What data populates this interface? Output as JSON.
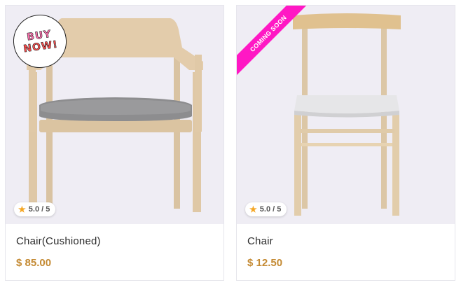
{
  "products": [
    {
      "title": "Chair(Cushioned)",
      "price": "$ 85.00",
      "rating": "5.0 / 5",
      "badge_line1": "BUY",
      "badge_line2": "NOW!"
    },
    {
      "title": "Chair",
      "price": "$ 12.50",
      "rating": "5.0 / 5",
      "ribbon": "COMING SOON"
    }
  ],
  "icons": {
    "rating": "star-icon"
  },
  "colors": {
    "price": "#c48a33",
    "star": "#f5a623",
    "ribbon": "#ff18c4",
    "image_bg": "#efedf4"
  }
}
